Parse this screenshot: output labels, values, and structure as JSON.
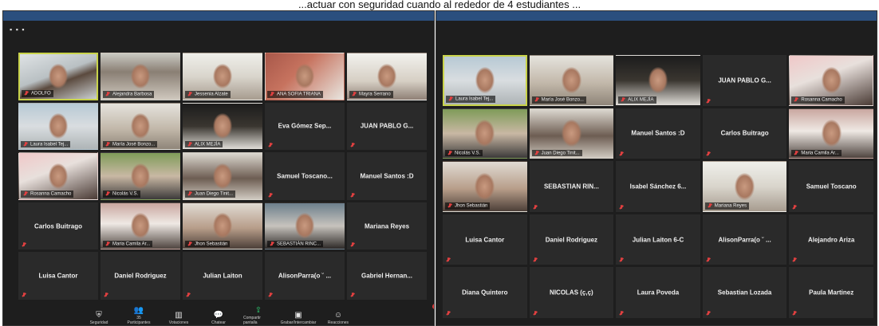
{
  "caption": "...actuar con seguridad cuando al rededor de 4 estudiantes ...",
  "left": {
    "tiles": [
      {
        "name": "",
        "label": "ADOLFO",
        "video": "v1",
        "active": true
      },
      {
        "name": "",
        "label": "Alejandra Barbosa",
        "video": "v2"
      },
      {
        "name": "",
        "label": "Jessenia Alzate",
        "video": "v3"
      },
      {
        "name": "",
        "label": "ANA SOFIA TRIANA",
        "video": "v4"
      },
      {
        "name": "",
        "label": "Mayra Serrano",
        "video": "v5"
      },
      {
        "name": "",
        "label": "Laura Isabel Tej...",
        "video": "v6"
      },
      {
        "name": "",
        "label": "María José Bonzo...",
        "video": "v7"
      },
      {
        "name": "",
        "label": "ALIX MEJÍA",
        "video": "v8"
      },
      {
        "name": "Eva Gómez Sep...",
        "label": ""
      },
      {
        "name": "JUAN PABLO G...",
        "label": ""
      },
      {
        "name": "",
        "label": "Rosanna Camacho",
        "video": "v9"
      },
      {
        "name": "",
        "label": "Nicolás V.S.",
        "video": "v10"
      },
      {
        "name": "",
        "label": "Juan Diego Tinit...",
        "video": "v11"
      },
      {
        "name": "Samuel Toscano...",
        "label": ""
      },
      {
        "name": "Manuel Santos :D",
        "label": ""
      },
      {
        "name": "Carlos Buitrago",
        "label": ""
      },
      {
        "name": "",
        "label": "Maria Camila Ar...",
        "video": "v12"
      },
      {
        "name": "",
        "label": "Jhon Sebastián",
        "video": "v13"
      },
      {
        "name": "",
        "label": "SEBASTIÁN RINC...",
        "video": "v14"
      },
      {
        "name": "Mariana Reyes",
        "label": ""
      },
      {
        "name": "Luisa Cantor",
        "label": ""
      },
      {
        "name": "Daniel Rodriguez",
        "label": ""
      },
      {
        "name": "Julian Laiton",
        "label": ""
      },
      {
        "name": "AlisonParra(o ˘ ...",
        "label": ""
      },
      {
        "name": "Gabriel Hernan...",
        "label": ""
      }
    ]
  },
  "right": {
    "tiles": [
      {
        "name": "",
        "label": "Laura Isabel Tej...",
        "video": "v6",
        "active": true
      },
      {
        "name": "",
        "label": "María José Bonzo...",
        "video": "v7"
      },
      {
        "name": "",
        "label": "ALIX MEJÍA",
        "video": "v8"
      },
      {
        "name": "JUAN PABLO G...",
        "label": ""
      },
      {
        "name": "",
        "label": "Rosanna Camacho",
        "video": "v9"
      },
      {
        "name": "",
        "label": "Nicolás V.S.",
        "video": "v10"
      },
      {
        "name": "",
        "label": "Juan Diego Tinit...",
        "video": "v11"
      },
      {
        "name": "Manuel Santos :D",
        "label": ""
      },
      {
        "name": "Carlos Buitrago",
        "label": ""
      },
      {
        "name": "",
        "label": "Maria Camila Ar...",
        "video": "v12"
      },
      {
        "name": "",
        "label": "Jhon Sebastián",
        "video": "v13"
      },
      {
        "name": "SEBASTIAN RIN...",
        "label": ""
      },
      {
        "name": "Isabel Sánchez 6...",
        "label": ""
      },
      {
        "name": "",
        "label": "Mariana Reyes",
        "video": "v3"
      },
      {
        "name": "Samuel Toscano",
        "label": ""
      },
      {
        "name": "Luisa Cantor",
        "label": ""
      },
      {
        "name": "Daniel Rodriguez",
        "label": ""
      },
      {
        "name": "Julian Laiton 6-C",
        "label": ""
      },
      {
        "name": "AlisonParra(o ˘ ...",
        "label": ""
      },
      {
        "name": "Alejandro Ariza",
        "label": ""
      },
      {
        "name": "Diana Quintero",
        "label": ""
      },
      {
        "name": "NICOLAS (ç,ç)",
        "label": ""
      },
      {
        "name": "Laura Poveda",
        "label": ""
      },
      {
        "name": "Sebastian Lozada",
        "label": ""
      },
      {
        "name": "Paula Martinez",
        "label": ""
      }
    ]
  },
  "toolbar": [
    {
      "label": "Seguridad",
      "icon": "shield-icon",
      "glyph": "⛨"
    },
    {
      "label": "Participantes",
      "icon": "participants-icon",
      "glyph": "👥",
      "count": "35"
    },
    {
      "label": "Votaciones",
      "icon": "polls-icon",
      "glyph": "▥"
    },
    {
      "label": "Chatear",
      "icon": "chat-icon",
      "glyph": "💬",
      "badge": "4"
    },
    {
      "label": "Compartir pantalla",
      "icon": "share-screen-icon",
      "glyph": "⇪"
    },
    {
      "label": "Grabar/Intercambiar",
      "icon": "record-icon",
      "glyph": "▣"
    },
    {
      "label": "Reacciones",
      "icon": "reactions-icon",
      "glyph": "☺"
    }
  ]
}
